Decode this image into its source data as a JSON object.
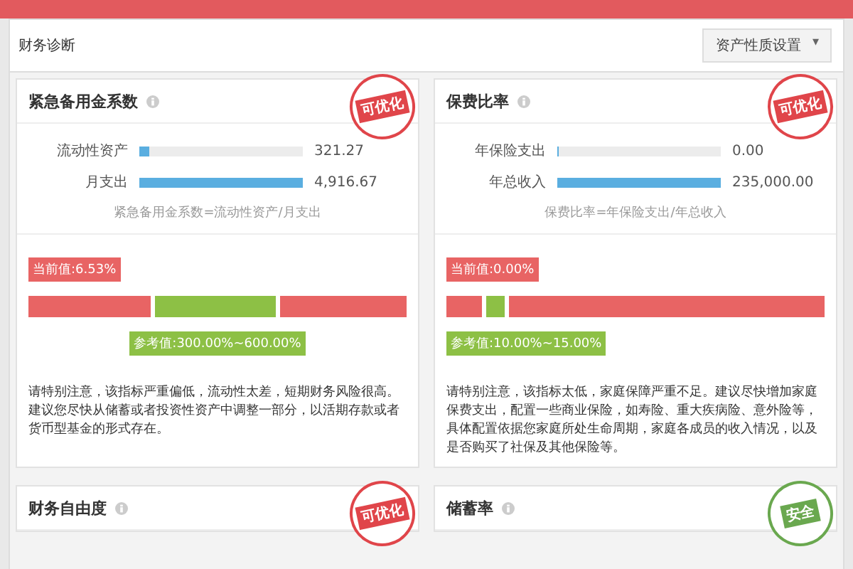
{
  "header": {
    "title": "财务诊断",
    "dropdown": {
      "label": "资产性质设置",
      "caret": "▾"
    }
  },
  "cards": [
    {
      "title": "紧急备用金系数",
      "stamp": {
        "kind": "warn",
        "text": "可优化"
      },
      "metrics": [
        {
          "label": "流动性资产",
          "level": 0.06,
          "value": "321.27"
        },
        {
          "label": "月支出",
          "level": 1,
          "value": "4,916.67"
        }
      ],
      "formula": "紧急备用金系数=流动性资产/月支出",
      "current": "当前值:6.53%",
      "range_bounds": [
        {
          "level": 0.33
        },
        {
          "level": 0.66
        }
      ],
      "reference": "参考值:300.00%~600.00%",
      "advice": "请特别注意，该指标严重偏低，流动性太差，短期财务风险很高。建议您尽快从储蓄或者投资性资产中调整一部分，以活期存款或者货币型基金的形式存在。"
    },
    {
      "title": "保费比率",
      "stamp": {
        "kind": "warn",
        "text": "可优化"
      },
      "metrics": [
        {
          "label": "年保险支出",
          "level": 0,
          "value": "0.00"
        },
        {
          "label": "年总收入",
          "level": 1,
          "value": "235,000.00"
        }
      ],
      "formula": "保费比率=年保险支出/年总收入",
      "current": "当前值:0.00%",
      "range_bounds": [
        {
          "level": 0.1
        },
        {
          "level": 0.16
        }
      ],
      "reference": "参考值:10.00%~15.00%",
      "advice": "请特别注意，该指标太低，家庭保障严重不足。建议尽快增加家庭保费支出，配置一些商业保险，如寿险、重大疾病险、意外险等，具体配置依据您家庭所处生命周期，家庭各成员的收入情况，以及是否购买了社保及其他保险等。"
    },
    {
      "title": "财务自由度",
      "stamp": {
        "kind": "warn",
        "text": "可优化"
      }
    },
    {
      "title": "储蓄率",
      "stamp": {
        "kind": "safe",
        "text": "安全"
      }
    }
  ]
}
